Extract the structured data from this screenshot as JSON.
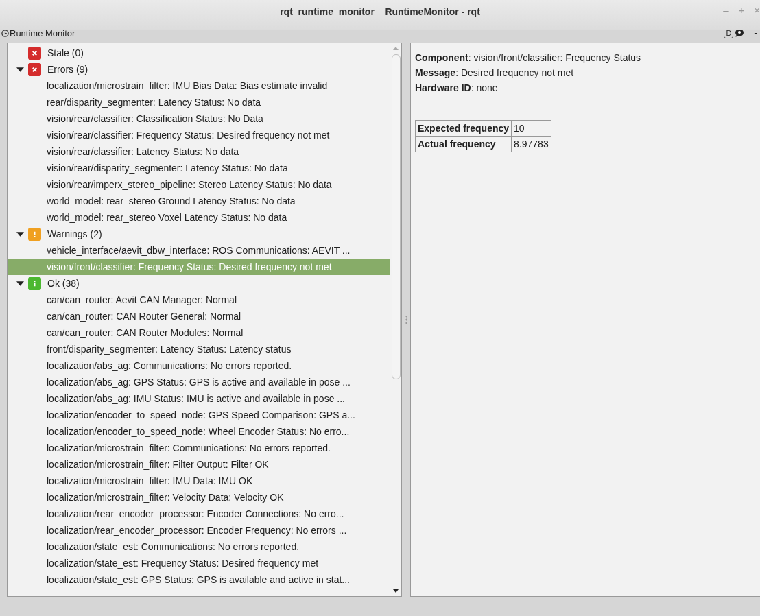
{
  "window": {
    "title": "rqt_runtime_monitor__RuntimeMonitor - rqt",
    "controls": [
      "–",
      "+",
      "×"
    ]
  },
  "plugin_bar": {
    "title": "Runtime Monitor",
    "buttons": [
      "D"
    ],
    "close": "-"
  },
  "tree": {
    "groups": [
      {
        "kind": "stale",
        "label": "Stale (0)"
      },
      {
        "kind": "error",
        "label": "Errors (9)",
        "expanded": true,
        "items": [
          {
            "text": "localization/microstrain_filter: IMU Bias Data: Bias estimate invalid",
            "selected": false
          },
          {
            "text": "rear/disparity_segmenter: Latency Status: No data",
            "selected": false
          },
          {
            "text": "vision/rear/classifier: Classification Status: No Data",
            "selected": false
          },
          {
            "text": "vision/rear/classifier: Frequency Status: Desired frequency not met",
            "selected": false
          },
          {
            "text": "vision/rear/classifier: Latency Status: No data",
            "selected": false
          },
          {
            "text": "vision/rear/disparity_segmenter: Latency Status: No data",
            "selected": false
          },
          {
            "text": "vision/rear/imperx_stereo_pipeline: Stereo Latency Status: No data",
            "selected": false
          },
          {
            "text": "world_model: rear_stereo Ground Latency Status: No data",
            "selected": false
          },
          {
            "text": "world_model: rear_stereo Voxel Latency Status: No data",
            "selected": false
          }
        ]
      },
      {
        "kind": "warning",
        "label": "Warnings (2)",
        "expanded": true,
        "items": [
          {
            "text": "vehicle_interface/aevit_dbw_interface: ROS Communications: AEVIT ...",
            "selected": false
          },
          {
            "text": "vision/front/classifier: Frequency Status: Desired frequency not met",
            "selected": true
          }
        ]
      },
      {
        "kind": "ok",
        "label": "Ok (38)",
        "expanded": true,
        "items": [
          {
            "text": "can/can_router: Aevit CAN Manager: Normal",
            "selected": false
          },
          {
            "text": "can/can_router: CAN Router General: Normal",
            "selected": false
          },
          {
            "text": "can/can_router: CAN Router Modules: Normal",
            "selected": false
          },
          {
            "text": "front/disparity_segmenter: Latency Status: Latency status",
            "selected": false
          },
          {
            "text": "localization/abs_ag: Communications: No errors reported.",
            "selected": false
          },
          {
            "text": "localization/abs_ag: GPS Status: GPS is active and available in pose ...",
            "selected": false
          },
          {
            "text": "localization/abs_ag: IMU Status: IMU is active and available in pose ...",
            "selected": false
          },
          {
            "text": "localization/encoder_to_speed_node: GPS Speed Comparison: GPS a...",
            "selected": false
          },
          {
            "text": "localization/encoder_to_speed_node: Wheel Encoder Status: No erro...",
            "selected": false
          },
          {
            "text": "localization/microstrain_filter: Communications: No errors reported.",
            "selected": false
          },
          {
            "text": "localization/microstrain_filter: Filter Output: Filter OK",
            "selected": false
          },
          {
            "text": "localization/microstrain_filter: IMU Data: IMU OK",
            "selected": false
          },
          {
            "text": "localization/microstrain_filter: Velocity Data: Velocity OK",
            "selected": false
          },
          {
            "text": "localization/rear_encoder_processor: Encoder Connections: No erro...",
            "selected": false
          },
          {
            "text": "localization/rear_encoder_processor: Encoder Frequency: No errors ...",
            "selected": false
          },
          {
            "text": "localization/state_est: Communications: No errors reported.",
            "selected": false
          },
          {
            "text": "localization/state_est: Frequency Status: Desired frequency met",
            "selected": false
          },
          {
            "text": "localization/state_est: GPS Status: GPS is available and active in stat...",
            "selected": false
          }
        ]
      }
    ]
  },
  "detail": {
    "fields": [
      "**Component**: vision/front/classifier: Frequency Status",
      "**Message**: Desired frequency not met",
      "**Hardware ID**: none"
    ],
    "table": [
      {
        "key": "Expected frequency",
        "value": "10"
      },
      {
        "key": "Actual frequency",
        "value": "8.97783"
      }
    ]
  }
}
